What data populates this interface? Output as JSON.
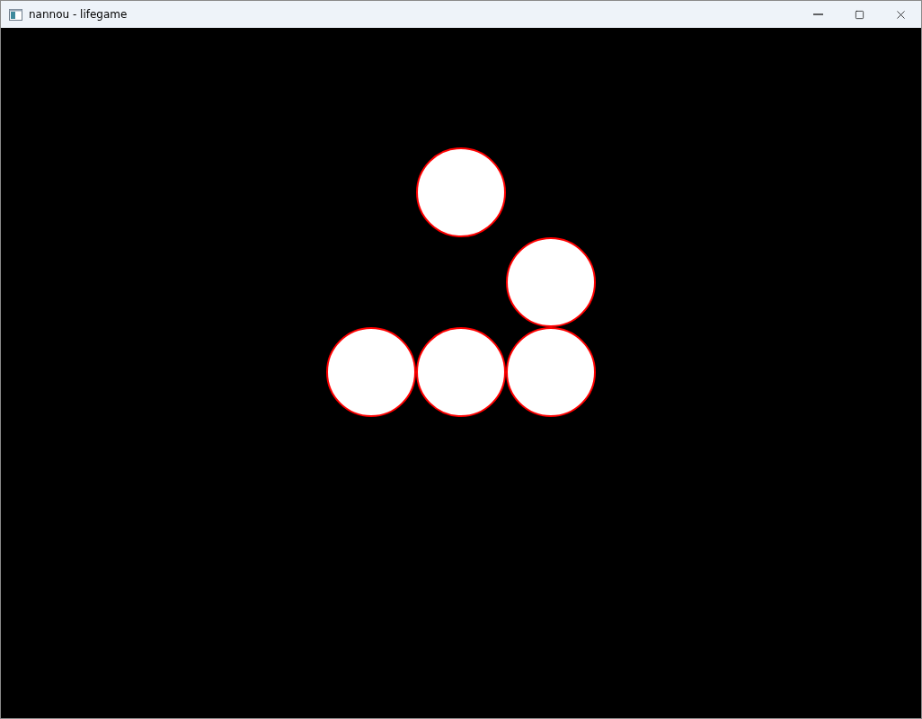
{
  "window": {
    "title": "nannou - lifegame"
  },
  "board": {
    "rows": [
      [
        {
          "alive": false
        },
        {
          "alive": true
        },
        {
          "alive": false
        }
      ],
      [
        {
          "alive": false
        },
        {
          "alive": false
        },
        {
          "alive": true
        }
      ],
      [
        {
          "alive": true
        },
        {
          "alive": true
        },
        {
          "alive": true
        }
      ]
    ]
  }
}
